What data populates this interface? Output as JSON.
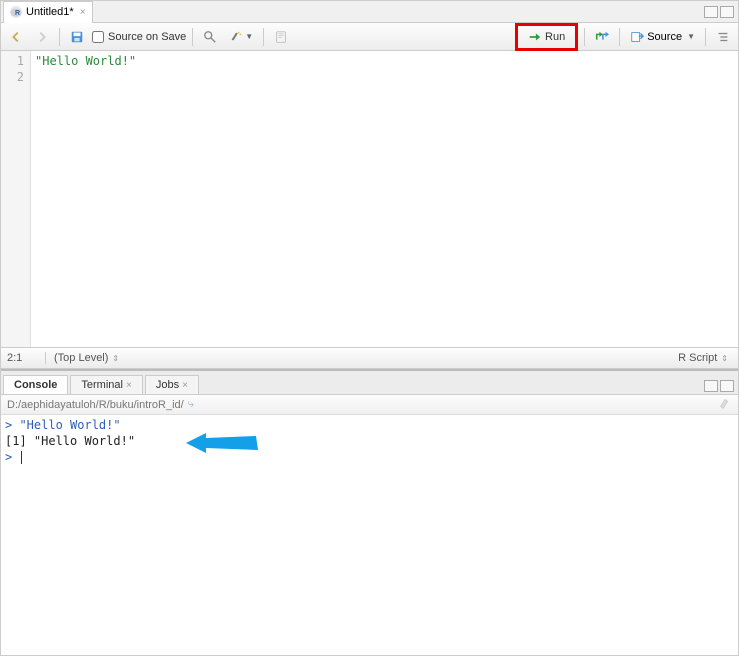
{
  "editor": {
    "tab": {
      "title": "Untitled1*"
    },
    "toolbar": {
      "source_on_save_label": "Source on Save",
      "run_label": "Run",
      "source_label": "Source"
    },
    "gutter": [
      "1",
      "2"
    ],
    "code_line_1": "\"Hello World!\"",
    "status": {
      "position": "2:1",
      "scope": "(Top Level)",
      "language": "R Script"
    }
  },
  "console": {
    "tabs": {
      "console": "Console",
      "terminal": "Terminal",
      "jobs": "Jobs"
    },
    "path": "D:/aephidayatuloh/R/buku/introR_id/",
    "lines": {
      "l1_prompt": ">",
      "l1_text": " \"Hello World!\"",
      "l2": "[1] \"Hello World!\"",
      "l3_prompt": ">"
    }
  }
}
